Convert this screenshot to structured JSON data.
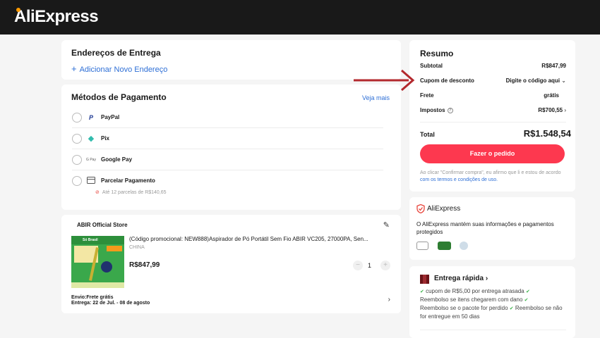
{
  "header": {
    "logo": "AliExpress"
  },
  "address": {
    "title": "Endereços de Entrega",
    "add_label": "Adicionar Novo Endereço"
  },
  "payment": {
    "title": "Métodos de Pagamento",
    "see_more": "Veja mais",
    "methods": [
      {
        "label": "PayPal",
        "icon": "paypal-icon"
      },
      {
        "label": "Pix",
        "icon": "pix-icon"
      },
      {
        "label": "Google Pay",
        "icon": "google-pay-icon"
      },
      {
        "label": "Parcelar Pagamento",
        "icon": "card-icon",
        "note": "Até 12 parcelas de R$140,65"
      }
    ]
  },
  "store": {
    "name": "ABIR Official Store",
    "product": {
      "title": "(Código promocional: NEW888)Aspirador de Pó Portátil Sem Fio ABIR VC205, 27000PA, Sen...",
      "origin": "CHINA",
      "price": "R$847,99",
      "quantity": "1",
      "thumb_banner": "Só Brasil"
    },
    "shipping": "Envio:Frete grátis",
    "delivery": "Entrega: 22 de Jul. - 08 de agosto"
  },
  "summary": {
    "title": "Resumo",
    "subtotal_label": "Subtotal",
    "subtotal": "R$847,99",
    "coupon_label": "Cupom de desconto",
    "coupon_value": "Digite o código aqui",
    "shipping_label": "Frete",
    "shipping_value": "grátis",
    "tax_label": "Impostos",
    "tax_value": "R$700,55",
    "total_label": "Total",
    "total": "R$1.548,54",
    "order_button": "Fazer o pedido",
    "terms_text": "Ao clicar \"Confirmar compra\", eu afirmo que li e estou de acordo",
    "terms_link": "com os termos e condições de uso."
  },
  "security": {
    "brand": "AliExpress",
    "text": "O AliExpress mantém suas informações e pagamentos protegidos"
  },
  "fast_delivery": {
    "title": "Entrega rápida",
    "lines": [
      "cupom de R$5,00 por entrega atrasada",
      "Reembolso se itens chegarem com dano",
      "Reembolso se o pacote for perdido",
      "Reembolso se não for entregue em 50 dias"
    ]
  },
  "colors": {
    "accent": "#fd384f",
    "link": "#2e6fd6",
    "header_bg": "#191919",
    "arrow": "#b3282d"
  }
}
